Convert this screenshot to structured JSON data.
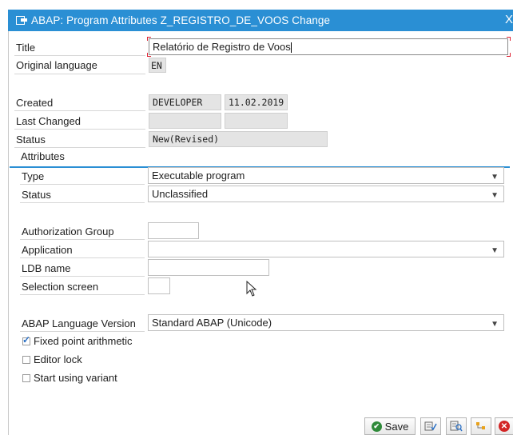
{
  "window": {
    "title": "ABAP: Program Attributes Z_REGISTRO_DE_VOOS Change",
    "close_glyph": "X"
  },
  "header": {
    "title_label": "Title",
    "title_value": "Relatório de Registro de Voos",
    "original_language_label": "Original language",
    "original_language_value": "EN",
    "created_label": "Created",
    "created_by": "DEVELOPER",
    "created_on": "11.02.2019",
    "last_changed_label": "Last Changed",
    "last_changed_by": "",
    "last_changed_on": "",
    "status_label": "Status",
    "status_value": "New(Revised)"
  },
  "attributes": {
    "section_label": "Attributes",
    "type_label": "Type",
    "type_value": "Executable program",
    "status_label": "Status",
    "status_value": "Unclassified",
    "authorization_group_label": "Authorization Group",
    "authorization_group_value": "",
    "application_label": "Application",
    "application_value": "",
    "ldb_name_label": "LDB name",
    "ldb_name_value": "",
    "selection_screen_label": "Selection screen",
    "selection_screen_value": "",
    "abap_language_version_label": "ABAP Language Version",
    "abap_language_version_value": "Standard ABAP (Unicode)",
    "fixed_point_label": "Fixed point arithmetic",
    "fixed_point_checked": true,
    "editor_lock_label": "Editor lock",
    "editor_lock_checked": false,
    "start_variant_label": "Start using variant",
    "start_variant_checked": false
  },
  "footer": {
    "save_label": "Save"
  },
  "colors": {
    "accent": "#2a8fd4",
    "save_icon": "#2f8a3a",
    "cancel_icon": "#d32525"
  }
}
